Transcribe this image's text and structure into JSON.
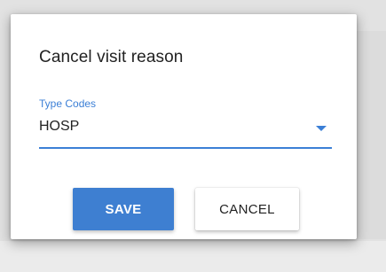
{
  "dialog": {
    "title": "Cancel visit reason",
    "field": {
      "label": "Type Codes",
      "value": "HOSP",
      "icon": "chevron-down-icon"
    },
    "buttons": {
      "save_label": "SAVE",
      "cancel_label": "CANCEL"
    }
  },
  "colors": {
    "accent": "#3b7fd6",
    "save_button": "#3e7fd1"
  }
}
